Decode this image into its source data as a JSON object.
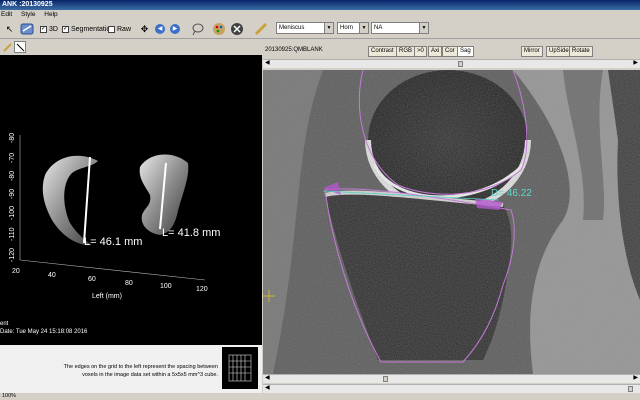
{
  "window": {
    "title": "ANK :20130925"
  },
  "menu": {
    "items": [
      "Edit",
      "Style",
      "Help"
    ]
  },
  "toolbar": {
    "check_3d": "3D",
    "check_segmentation": "Segmentation",
    "check_raw": "Raw",
    "select_structure": "Meniscus",
    "select_part": "Horn",
    "select_compartment": "NA"
  },
  "render3d": {
    "measurement_left": "L= 46.1 mm",
    "measurement_right": "L= 41.8 mm",
    "z_ticks": [
      "-80",
      "-70",
      "-80",
      "-90",
      "-100",
      "-110",
      "-120"
    ],
    "x_ticks": [
      "20",
      "40",
      "60",
      "80",
      "100",
      "120"
    ],
    "x_axis_label": "Left (mm)",
    "info_line1": "ent",
    "info_line2": "Date: Tue May 24 15:18:08 2016"
  },
  "info": {
    "text_line1": "The edges on the grid to the left represent the spacing between",
    "text_line2": "voxels in the image data set within a 5x5x5 mm^3 cube."
  },
  "mri": {
    "title": "20130925:QMBLANK",
    "view_buttons": [
      "Contrast",
      "RGB",
      ">0",
      "Axi",
      "Cor",
      "Sag"
    ],
    "active_view": "Sag",
    "action_buttons": [
      "Mirror",
      "UpSide",
      "Rotate"
    ],
    "measurement": "D= 46.22"
  },
  "status": {
    "zoom": "100%"
  }
}
